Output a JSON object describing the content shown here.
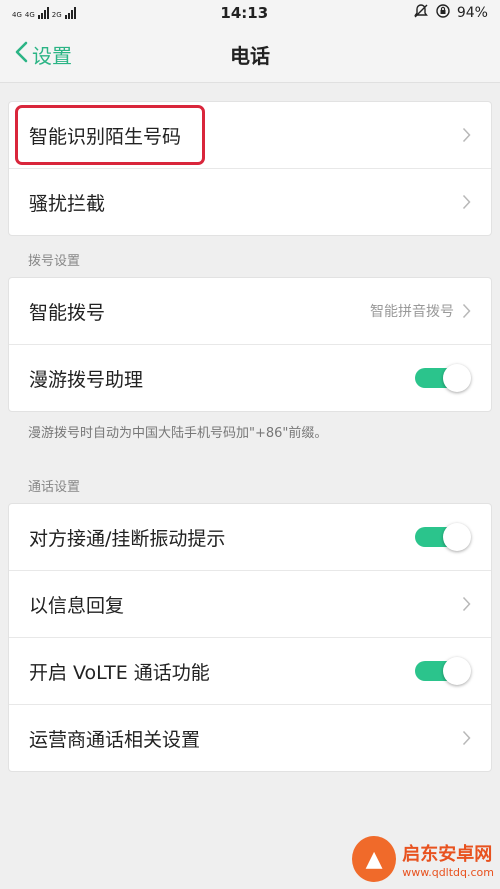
{
  "status_bar": {
    "network_a": "4G",
    "network_b": "4G",
    "network_c": "2G",
    "time": "14:13",
    "battery": "94%"
  },
  "nav": {
    "back_label": "设置",
    "title": "电话"
  },
  "group1": {
    "items": [
      {
        "label": "智能识别陌生号码"
      },
      {
        "label": "骚扰拦截"
      }
    ]
  },
  "dial_settings": {
    "header": "拨号设置",
    "smart_dial": {
      "label": "智能拨号",
      "value": "智能拼音拨号"
    },
    "roaming_assistant": {
      "label": "漫游拨号助理",
      "enabled": true
    },
    "note": "漫游拨号时自动为中国大陆手机号码加\"+86\"前缀。"
  },
  "call_settings": {
    "header": "通话设置",
    "vibrate": {
      "label": "对方接通/挂断振动提示",
      "enabled": true
    },
    "sms_reply": {
      "label": "以信息回复"
    },
    "volte": {
      "label": "开启 VoLTE 通话功能",
      "enabled": true
    },
    "carrier": {
      "label": "运营商通话相关设置"
    }
  },
  "watermark": {
    "name": "启东安卓网",
    "url": "www.qdltdq.com"
  },
  "colors": {
    "accent": "#2bb485",
    "toggle_on": "#2bc48c",
    "highlight": "#d9263b"
  }
}
